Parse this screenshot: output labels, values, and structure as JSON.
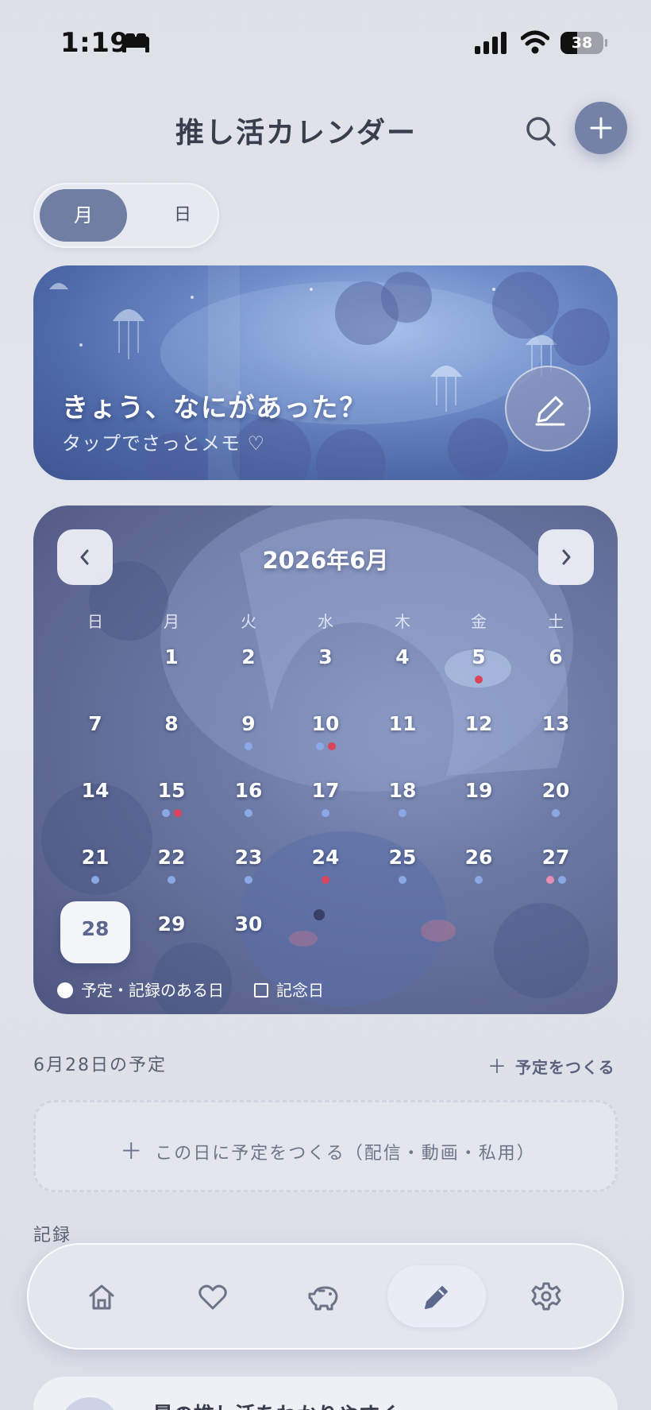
{
  "status_bar": {
    "time": "1:19",
    "battery": "38",
    "battery_level": 0.38
  },
  "header": {
    "title": "推し活カレンダー"
  },
  "view_toggle": {
    "month_label": "月",
    "day_label": "日",
    "selected": "月"
  },
  "banner": {
    "title": "きょう、なにがあった？",
    "subtitle": "タップでさっとメモ ♡"
  },
  "calendar": {
    "title": "2026年6月",
    "weekdays": [
      "日",
      "月",
      "火",
      "水",
      "木",
      "金",
      "土"
    ],
    "first_weekday_index": 1,
    "days_in_month": 30,
    "today": 28,
    "dot_colors": {
      "blue": "#8aa8e6",
      "red": "#d9455a",
      "pink": "#e68fb3"
    },
    "dots": {
      "5": [
        "red"
      ],
      "9": [
        "blue"
      ],
      "10": [
        "blue",
        "red"
      ],
      "15": [
        "blue",
        "red"
      ],
      "16": [
        "blue"
      ],
      "17": [
        "blue"
      ],
      "18": [
        "blue"
      ],
      "20": [
        "blue"
      ],
      "21": [
        "blue"
      ],
      "22": [
        "blue"
      ],
      "23": [
        "blue"
      ],
      "24": [
        "red"
      ],
      "25": [
        "blue"
      ],
      "26": [
        "blue"
      ],
      "27": [
        "pink",
        "blue"
      ]
    },
    "legend": {
      "events": "予定・記録のある日",
      "anniversary": "記念日"
    }
  },
  "schedule": {
    "heading": "6月28日の予定",
    "create_link": "予定をつくる",
    "empty_text": "この日に予定をつくる（配信・動画・私用）"
  },
  "records": {
    "heading": "記録",
    "next_card_title": "最の推し活をわかりやすく"
  },
  "tab_bar": {
    "items": [
      {
        "icon": "home-icon"
      },
      {
        "icon": "heart-icon"
      },
      {
        "icon": "piggy-bank-icon"
      },
      {
        "icon": "pencil-icon",
        "active": true
      },
      {
        "icon": "gear-icon"
      }
    ]
  },
  "colors": {
    "accent": "#7482a8",
    "background": "#e1e3ea"
  }
}
